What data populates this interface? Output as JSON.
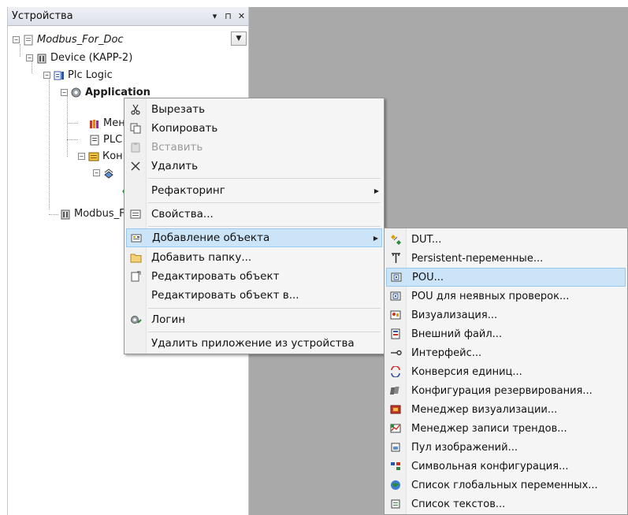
{
  "panel": {
    "title": "Устройства",
    "header_buttons": {
      "dropdown": "▾",
      "pin": "⊓",
      "close": "✕"
    },
    "tree": {
      "root": "Modbus_For_Doc",
      "device": "Device (KAPP-2)",
      "plc_logic": "Plc Logic",
      "application": "Application",
      "child_manager": "Мен",
      "child_plc": "PLC",
      "child_config": "Кон",
      "child_modbus": "Modbus_F"
    }
  },
  "context_menu": {
    "items": [
      {
        "label": "Вырезать",
        "icon": "scissors-icon"
      },
      {
        "label": "Копировать",
        "icon": "copy-icon"
      },
      {
        "label": "Вставить",
        "icon": "paste-icon",
        "disabled": true
      },
      {
        "label": "Удалить",
        "icon": "delete-icon"
      },
      {
        "label": "Рефакторинг",
        "icon": "",
        "submenu": true
      },
      {
        "label": "Свойства...",
        "icon": "properties-icon"
      },
      {
        "label": "Добавление объекта",
        "icon": "add-object-icon",
        "submenu": true,
        "highlighted": true
      },
      {
        "label": "Добавить папку...",
        "icon": "folder-icon"
      },
      {
        "label": "Редактировать объект",
        "icon": "edit-object-icon"
      },
      {
        "label": "Редактировать объект в...",
        "icon": ""
      },
      {
        "label": "Логин",
        "icon": "login-icon"
      },
      {
        "label": "Удалить приложение из устройства",
        "icon": ""
      }
    ]
  },
  "submenu": {
    "items": [
      {
        "label": "DUT...",
        "icon": "dut-icon"
      },
      {
        "label": "Persistent-переменные...",
        "icon": "persistent-icon"
      },
      {
        "label": "POU...",
        "icon": "pou-icon",
        "highlighted": true
      },
      {
        "label": "POU для неявных проверок...",
        "icon": "pou-check-icon"
      },
      {
        "label": "Визуализация...",
        "icon": "visualization-icon"
      },
      {
        "label": "Внешний файл...",
        "icon": "external-file-icon"
      },
      {
        "label": "Интерфейс...",
        "icon": "interface-icon"
      },
      {
        "label": "Конверсия единиц...",
        "icon": "unit-conversion-icon"
      },
      {
        "label": "Конфигурация резервирования...",
        "icon": "redundancy-icon"
      },
      {
        "label": "Менеджер визуализации...",
        "icon": "visu-manager-icon"
      },
      {
        "label": "Менеджер записи трендов...",
        "icon": "trend-manager-icon"
      },
      {
        "label": "Пул изображений...",
        "icon": "image-pool-icon"
      },
      {
        "label": "Символьная конфигурация...",
        "icon": "symbol-config-icon"
      },
      {
        "label": "Список глобальных переменных...",
        "icon": "gvl-icon"
      },
      {
        "label": "Список текстов...",
        "icon": "text-list-icon"
      }
    ]
  },
  "colors": {
    "highlight": "#cce4f7",
    "highlight_border": "#99c9ef",
    "menu_bg": "#f5f5f5",
    "workspace": "#a9a9a9"
  }
}
